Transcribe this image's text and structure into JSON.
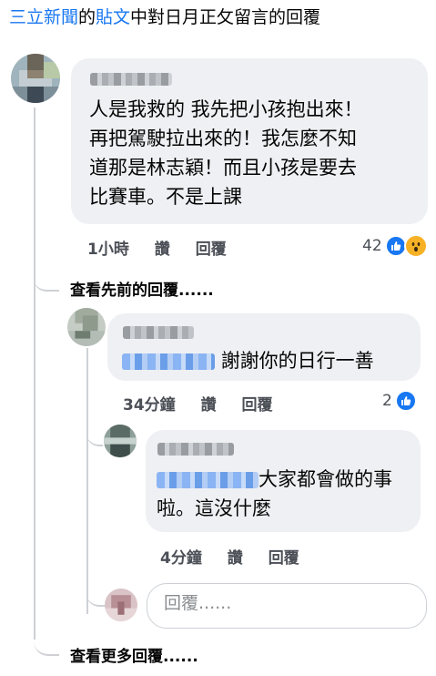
{
  "caption": {
    "source": "三立新聞",
    "mid": "的",
    "post": "貼文",
    "rest": "中對日月正攵留言的回覆"
  },
  "comments": [
    {
      "text_lines": [
        "人是我救的 我先把小孩抱出來！",
        "再把駕駛拉出來的！我怎麼不知",
        "道那是林志穎！而且小孩是要去",
        "比賽車。不是上課"
      ],
      "time": "1小時",
      "like": "讚",
      "reply": "回覆",
      "reactions": "42"
    },
    {
      "text": "謝謝你的日行一善",
      "time": "34分鐘",
      "like": "讚",
      "reply": "回覆",
      "reactions": "2"
    },
    {
      "text_line1": "大家都會做的事",
      "text_line2": "啦。這沒什麼",
      "time": "4分鐘",
      "like": "讚",
      "reply": "回覆"
    }
  ],
  "view_previous": "查看先前的回覆......",
  "reply_placeholder": "回覆......",
  "view_more": "查看更多回覆......",
  "colors": {
    "link": "#1877f2",
    "bubble": "#eef0f3",
    "like": "#1877f2",
    "wow": "#f7b125"
  }
}
